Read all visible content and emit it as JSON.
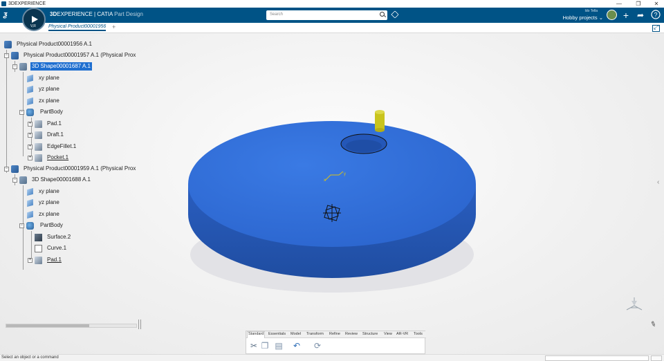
{
  "window": {
    "title": "3DEXPERIENCE",
    "controls": [
      "—",
      "❐",
      "✕"
    ]
  },
  "topbar": {
    "brand_prefix": "3D",
    "brand_main": "EXPERIENCE | CATIA",
    "brand_app": "Part Design",
    "compass_label": "V,R",
    "search_placeholder": "Search",
    "user_name": "Ido Tella",
    "project": "Hobby projects ⌄",
    "icons": [
      "add-icon",
      "share-icon",
      "help-icon"
    ]
  },
  "tabs": {
    "active": "Physical Product00001956",
    "add": "+"
  },
  "tree": {
    "root": "Physical Product00001956 A.1",
    "product1": "Physical Product00001957 A.1 (Physical Prox",
    "shape1": "3D Shape00001687 A.1",
    "shape1_items": [
      "xy plane",
      "yz plane",
      "zx plane",
      "PartBody",
      "Pad.1",
      "Draft.1",
      "EdgeFillet.1",
      "Pocket.1"
    ],
    "product2": "Physical Product00001959 A.1 (Physical Prox",
    "shape2": "3D Shape00001688 A.1",
    "shape2_items": [
      "xy plane",
      "yz plane",
      "zx plane",
      "PartBody",
      "Surface.2",
      "Curve.1",
      "Pad.1"
    ]
  },
  "viewport": {
    "disc_color": "#2f6fd6",
    "disc_side_color": "#2456b0",
    "pin_color": "#c9c41d",
    "axis_labels": [
      "x",
      "y"
    ]
  },
  "actionbar": {
    "tabs": [
      "Standard",
      "Essentials",
      "Model",
      "Transform",
      "Refine",
      "Review",
      "Structure",
      "View",
      "AR-VR",
      "Tools"
    ],
    "active_tab": "Standard"
  },
  "status": {
    "text": "Select an object or a command"
  }
}
